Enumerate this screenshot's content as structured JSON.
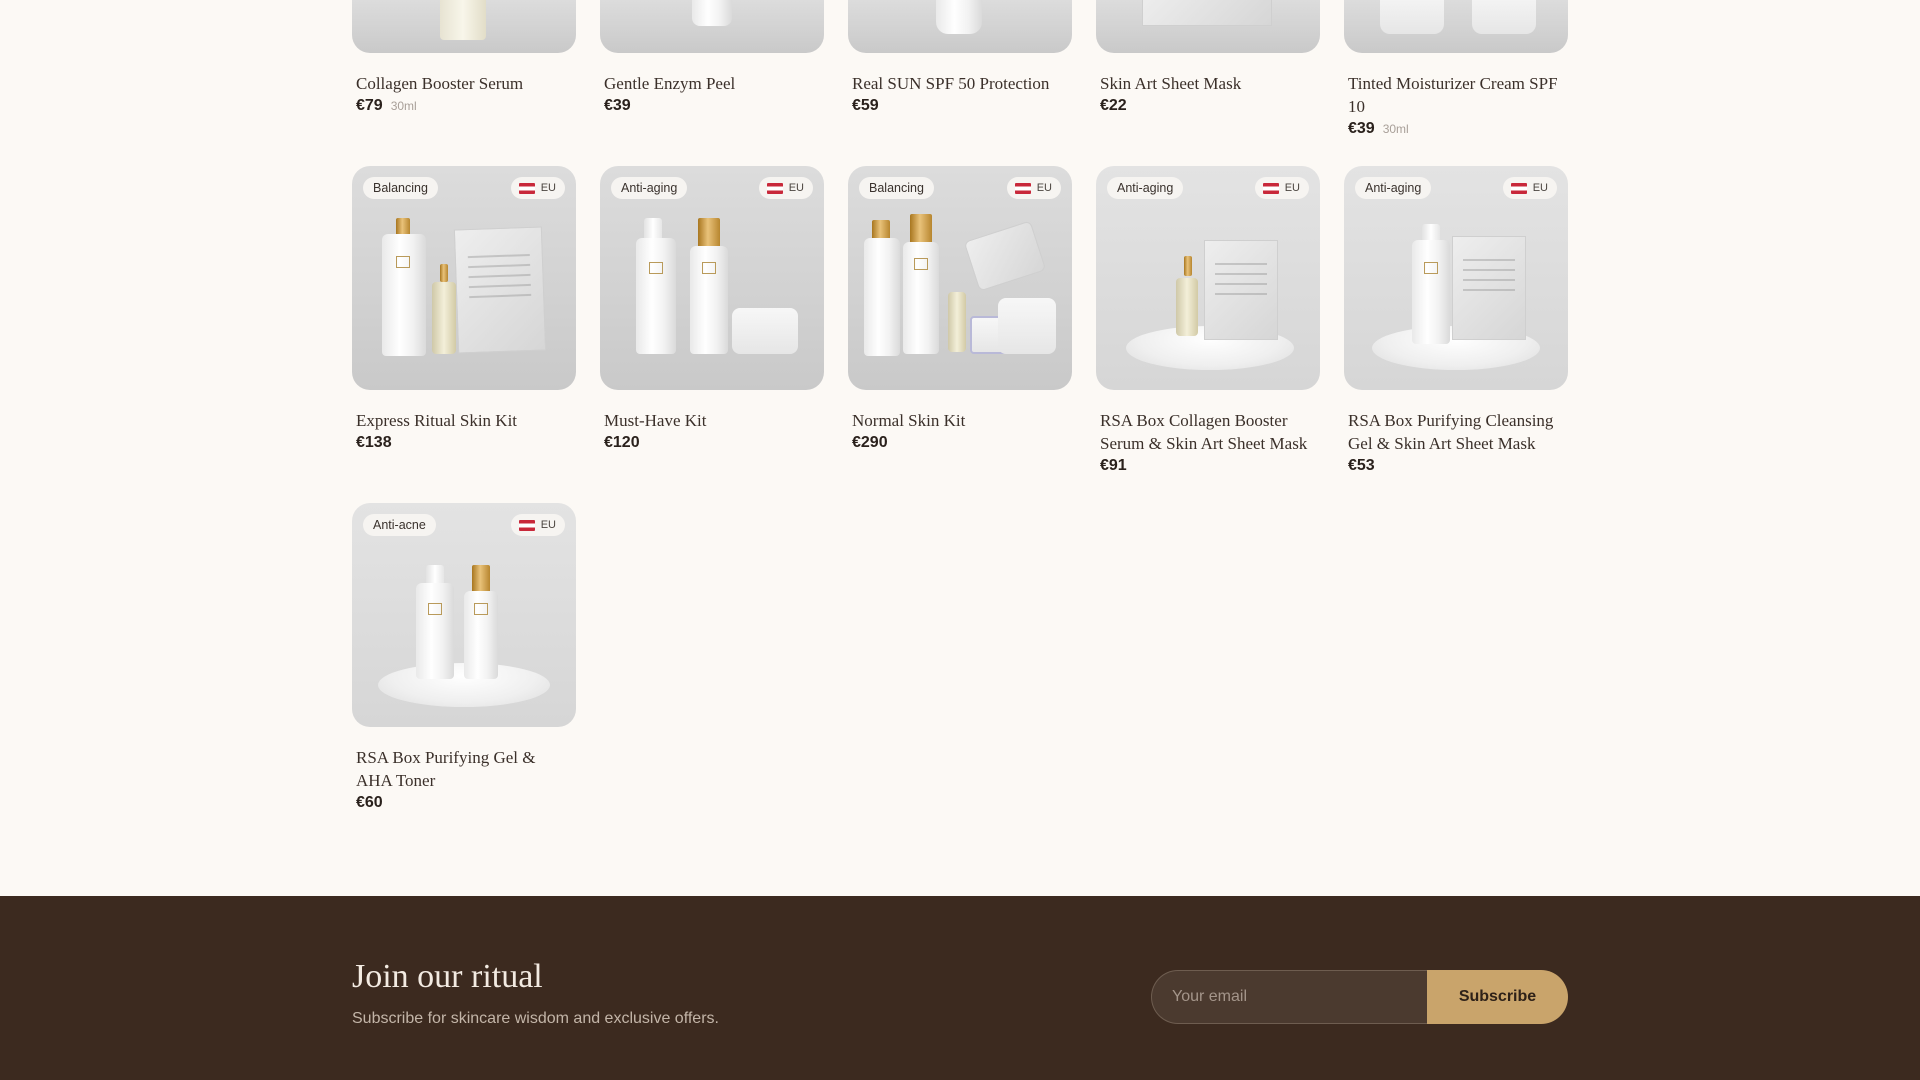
{
  "products_row1": [
    {
      "name": "Collagen Booster Serum",
      "price": "€79",
      "volume": "30ml"
    },
    {
      "name": "Gentle Enzym Peel",
      "price": "€39",
      "volume": ""
    },
    {
      "name": "Real SUN SPF 50 Protection",
      "price": "€59",
      "volume": ""
    },
    {
      "name": "Skin Art Sheet Mask",
      "price": "€22",
      "volume": ""
    },
    {
      "name": "Tinted Moisturizer Cream SPF 10",
      "price": "€39",
      "volume": "30ml"
    }
  ],
  "products_row2": [
    {
      "tag": "Balancing",
      "region": "EU",
      "name": "Express Ritual Skin Kit",
      "price": "€138"
    },
    {
      "tag": "Anti-aging",
      "region": "EU",
      "name": "Must-Have Kit",
      "price": "€120"
    },
    {
      "tag": "Balancing",
      "region": "EU",
      "name": "Normal Skin Kit",
      "price": "€290"
    },
    {
      "tag": "Anti-aging",
      "region": "EU",
      "name": "RSA Box Collagen Booster Serum & Skin Art Sheet Mask",
      "price": "€91"
    },
    {
      "tag": "Anti-aging",
      "region": "EU",
      "name": "RSA Box Purifying Cleansing Gel & Skin Art Sheet Mask",
      "price": "€53"
    }
  ],
  "products_row3": [
    {
      "tag": "Anti-acne",
      "region": "EU",
      "name": "RSA Box Purifying Gel & AHA Toner",
      "price": "€60"
    }
  ],
  "icons": {
    "region_flag": "austria-flag-icon"
  },
  "colors": {
    "page_bg": "#fcf9f5",
    "footer_bg": "#3c2a1f",
    "accent": "#c9a46b"
  },
  "newsletter": {
    "title": "Join our ritual",
    "subtitle": "Subscribe for skincare wisdom and exclusive offers.",
    "email_placeholder": "Your email",
    "email_value": "",
    "button": "Subscribe"
  }
}
